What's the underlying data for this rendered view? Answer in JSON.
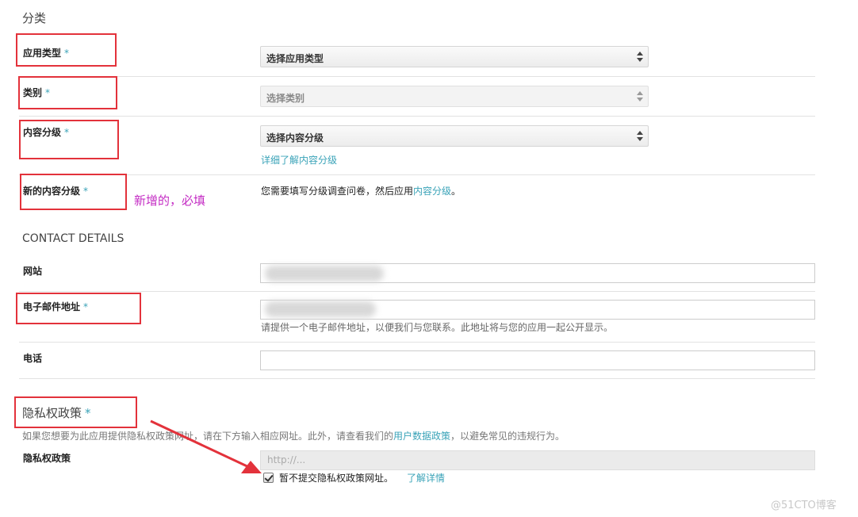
{
  "category": {
    "section_title": "分类",
    "app_type": {
      "label": "应用类型",
      "required_mark": "*",
      "select_value": "选择应用类型"
    },
    "category": {
      "label": "类别",
      "required_mark": "*",
      "select_value": "选择类别"
    },
    "content_rating": {
      "label": "内容分级",
      "required_mark": "*",
      "select_value": "选择内容分级",
      "help_link": "详细了解内容分级"
    },
    "new_content_rating": {
      "label": "新的内容分级",
      "required_mark": "*",
      "text_before": "您需要填写分级调查问卷，然后应用",
      "link": "内容分级",
      "text_after": "。"
    }
  },
  "contact": {
    "section_title": "CONTACT DETAILS",
    "website": {
      "label": "网站"
    },
    "email": {
      "label": "电子邮件地址",
      "required_mark": "*",
      "help": "请提供一个电子邮件地址，以便我们与您联系。此地址将与您的应用一起公开显示。"
    },
    "phone": {
      "label": "电话"
    }
  },
  "privacy": {
    "section_title": "隐私权政策",
    "required_mark": "*",
    "desc_before": "如果您想要为此应用提供隐私权政策网址，请在下方输入相应网址。此外，请查看我们的",
    "desc_link": "用户数据政策",
    "desc_after": "，以避免常见的违规行为。",
    "field_label": "隐私权政策",
    "url_placeholder": "http://...",
    "checkbox_label": "暂不提交隐私权政策网址。",
    "learn_more": "了解详情",
    "checkbox_checked": true
  },
  "annotation": {
    "text": "新增的，必填",
    "color": "#c42cc4",
    "box_color": "#e3323b"
  },
  "watermark": "@51CTO博客"
}
